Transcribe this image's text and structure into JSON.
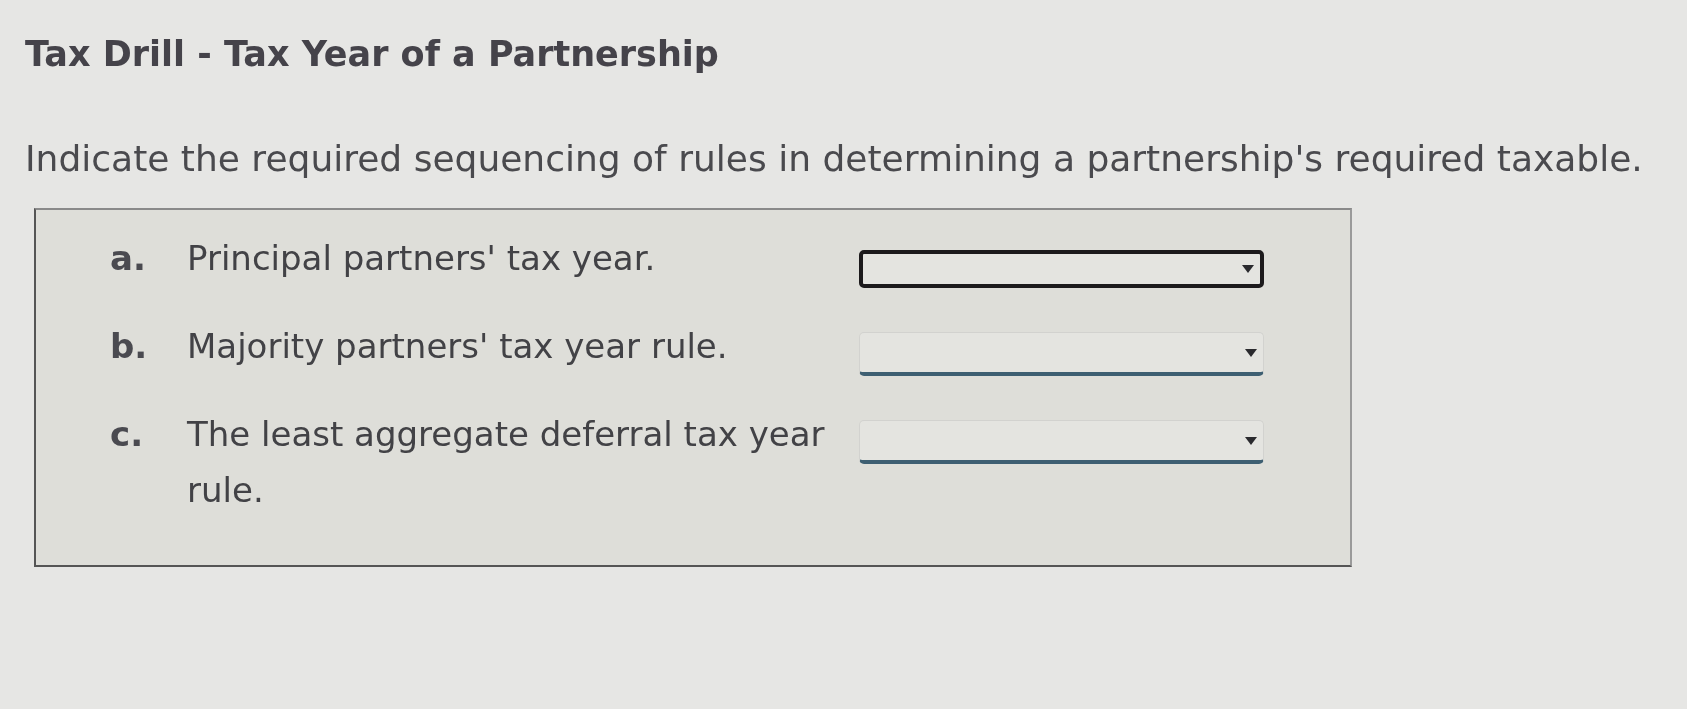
{
  "title": "Tax Drill - Tax Year of a Partnership",
  "instruction": "Indicate the required sequencing of rules in determining a partnership's required taxable.",
  "items": [
    {
      "letter": "a.",
      "text": "Principal partners' tax year.",
      "dropdown": {
        "focused": true
      }
    },
    {
      "letter": "b.",
      "text": "Majority partners' tax year rule.",
      "dropdown": {
        "focused": false
      }
    },
    {
      "letter": "c.",
      "text": "The least aggregate deferral tax year rule.",
      "dropdown": {
        "focused": false
      }
    }
  ]
}
